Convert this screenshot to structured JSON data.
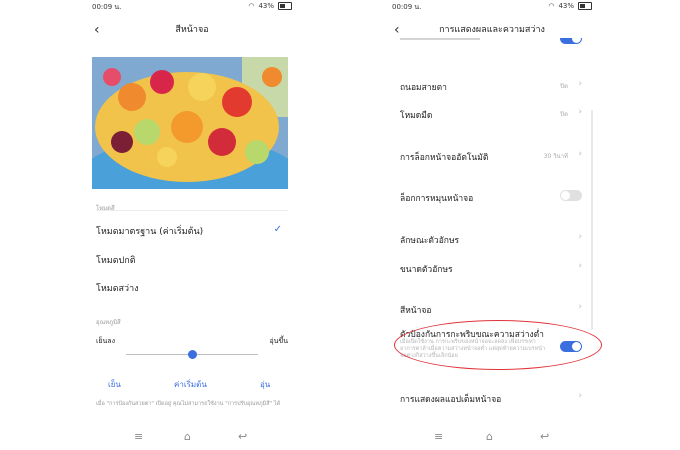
{
  "left": {
    "status": {
      "time": "00:09 น.",
      "battery": "43%"
    },
    "header": {
      "title": "สีหน้าจอ"
    },
    "section_mode": "โหมดสี",
    "modes": [
      {
        "label": "โหมดมาตรฐาน (ค่าเริ่มต้น)",
        "selected": true
      },
      {
        "label": "โหมดปกติ",
        "selected": false
      },
      {
        "label": "โหมดสว่าง",
        "selected": false
      }
    ],
    "section_temp": "อุณหภูมิสี",
    "temp_left": "เย็นลง",
    "temp_right": "อุ่นขึ้น",
    "temp_level": 0.5,
    "buttons": {
      "cool": "เย็น",
      "default": "ค่าเริ่มต้น",
      "warm": "อุ่น"
    },
    "note": "เมื่อ \"การป้องกันสวยตา\" เปิดอยู่ คุณไม่สามารถใช้งาน \"การปรับอุณหภูมิสี\" ได้"
  },
  "right": {
    "status": {
      "time": "00:09 น.",
      "battery": "43%"
    },
    "header": {
      "title": "การแสดงผลและความสว่าง"
    },
    "rows": {
      "eye": {
        "label": "ถนอมสายตา",
        "value": "ปิด"
      },
      "dark": {
        "label": "โหมดมืด",
        "value": "ปิด"
      },
      "autolock": {
        "label": "การล็อกหน้าจออัตโนมัติ",
        "value": "30 วินาที"
      },
      "rotate": {
        "label": "ล็อกการหมุนหน้าจอ"
      },
      "font_style": {
        "label": "ลักษณะตัวอักษร"
      },
      "font_size": {
        "label": "ขนาดตัวอักษร"
      },
      "screen_color": {
        "label": "สีหน้าจอ"
      },
      "flicker": {
        "label": "ตัวป้องกันการกะพริบขณะความสว่างต่ำ",
        "desc": "เมื่อเปิดใช้งาน การกะพริบของหน้าจอจะลดลง เพื่อบรรเทาอาการตาล้าเมื่อความสว่างหน้าจอต่ำ แต่สุดท้ายความเบรหน้าจอต่างก็สว่างขึ้นเล็กน้อย"
      },
      "extra": {
        "label": "การแสดงผลแอปเต็มหน้าจอ"
      }
    }
  },
  "colors": {
    "accent": "#3b6fe0",
    "highlight": "#e0353b"
  }
}
